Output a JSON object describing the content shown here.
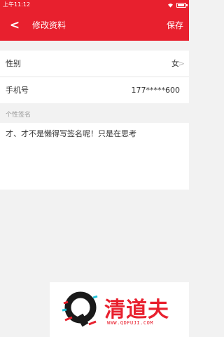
{
  "statusbar": {
    "time": "上午11:12"
  },
  "header": {
    "back_glyph": "<",
    "title": "修改资料",
    "save_label": "保存"
  },
  "profile": {
    "gender": {
      "label": "性别",
      "value": "女",
      "arrow": ">"
    },
    "phone": {
      "label": "手机号",
      "value": "177*****600"
    }
  },
  "signature": {
    "section_label": "个性签名",
    "text": "才、才不是懒得写签名呢！只是在思考"
  },
  "watermark": {
    "brand": "清道夫",
    "url": "WWW.QDFUJI.COM"
  },
  "colors": {
    "accent": "#e8202e",
    "background": "#f2f2f2"
  }
}
